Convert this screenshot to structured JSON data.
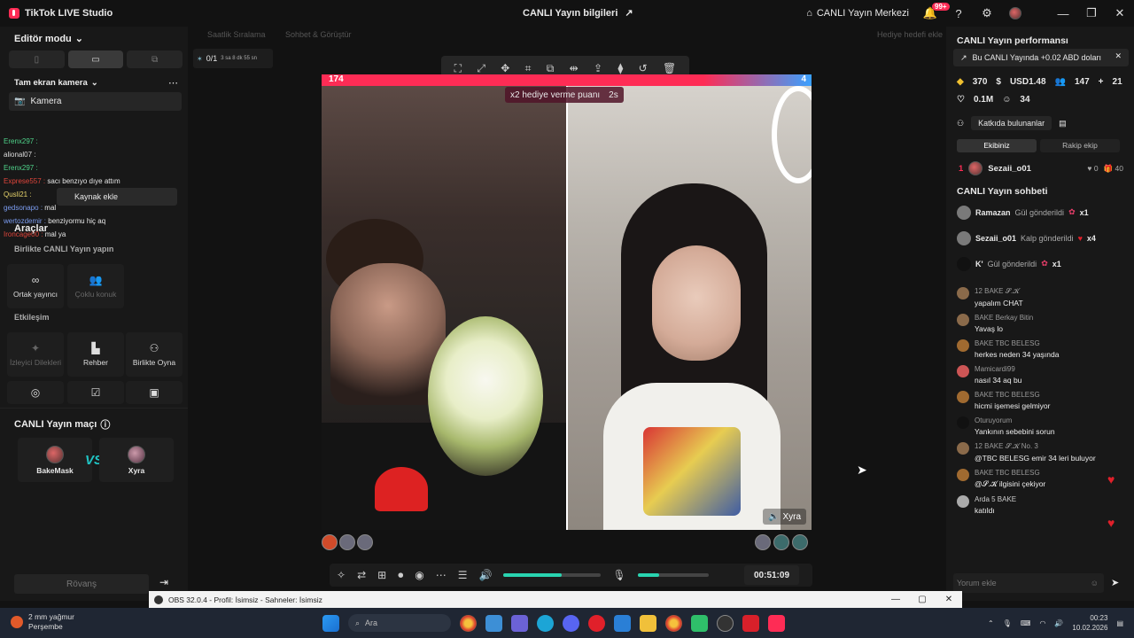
{
  "titlebar": {
    "app_name": "TikTok LIVE Studio",
    "center_title": "CANLI Yayın bilgileri",
    "live_center": "CANLI Yayın Merkezi",
    "notif_badge": "99+"
  },
  "left": {
    "editor_mode": "Editör modu",
    "camera_section": "Tam ekran kamera",
    "camera_item": "Kamera",
    "mini_chat": [
      {
        "user": "Erenx297 :",
        "text": ""
      },
      {
        "user": "alional07 :",
        "text": ""
      },
      {
        "user": "Erenx297 :",
        "text": ""
      },
      {
        "user": "Exprese557 :",
        "text": "sacı benzıyo dıye attım"
      },
      {
        "user": "Qusli21 :",
        "text": ""
      },
      {
        "user": "gedsonapo :",
        "text": "mal"
      },
      {
        "user": "wertozdemir :",
        "text": "benziyormu hiç aq"
      },
      {
        "user": "Ironcage00 :",
        "text": "mal ya"
      }
    ],
    "add_source": "Kaynak ekle",
    "tools_title": "Araçlar",
    "collab_title": "Birlikte CANLI Yayın yapın",
    "tool_cohost": "Ortak yayıncı",
    "tool_multiguest": "Çoklu konuk",
    "interaction_title": "Etkileşim",
    "tool_viewer_wishes": "İzleyici Dilekleri",
    "tool_guide": "Rehber",
    "tool_playtogether": "Birlikte Oyna",
    "match_title": "CANLI Yayın maçı",
    "player1": "BakeMask",
    "player2": "Xyra",
    "vs": "VS",
    "rematch": "Rövanş"
  },
  "stage": {
    "label_left1": "Saatlik Sıralama",
    "label_left2": "Sohbet & Görüştür",
    "label_right": "Hediye hedefi ekle",
    "streak": "0/1",
    "streak_time": "3 sa 8 dk 55 sn",
    "score_left": "174",
    "score_right": "4",
    "gift_multiplier": "x2 hediye verme puanı",
    "gift_timer": "2s",
    "guest_name": "Xyra",
    "elapsed": "00:51:09",
    "volume_level": 0.6,
    "mic_level": 0.3
  },
  "right": {
    "perf_title": "CANLI Yayın performansı",
    "earn_text": "Bu CANLI Yayında +0.02 ABD doları",
    "stat_diamonds": "370",
    "stat_usd": "USD1.48",
    "stat_viewers": "147",
    "stat_follows": "21",
    "stat_likes": "0.1M",
    "stat_gifters": "34",
    "contrib_btn": "Katkıda bulunanlar",
    "tab_team": "Ekibiniz",
    "tab_rival": "Rakip ekip",
    "rank_no": "1",
    "rank_user": "Sezaii_o01",
    "rank_likes": "0",
    "rank_gifts": "40",
    "chat_title": "CANLI Yayın sohbeti",
    "gifts": [
      {
        "user": "Ramazan",
        "action": "Gül gönderildi",
        "count": "x1"
      },
      {
        "user": "Sezaii_o01",
        "action": "Kalp gönderildi",
        "count": "x4"
      },
      {
        "user": "K'",
        "action": "Gül gönderildi",
        "count": "x1"
      }
    ],
    "messages": [
      {
        "name": "12  BAKE 𝓢.𝓚",
        "text": "yapalım CHAT"
      },
      {
        "name": "BAKE Berkay Bitin",
        "text": "Yavaş lo"
      },
      {
        "name": "BAKE TBC BELESG",
        "text": "herkes neden 34 yaşında"
      },
      {
        "name": "Mamicardi99",
        "text": "nasıl 34 aq bu"
      },
      {
        "name": "BAKE TBC BELESG",
        "text": "hicmi işemesi gelmiyor"
      },
      {
        "name": "Oturuyorum",
        "text": "Yankının sebebini sorun"
      },
      {
        "name": "12  BAKE 𝓢.𝓚  No. 3",
        "text": "@TBC BELESG emir 34 leri buluyor"
      },
      {
        "name": "BAKE TBC BELESG",
        "text": "@𝓢.𝓚 ilgisini çekiyor"
      },
      {
        "name": "Arda  5  BAKE",
        "text": "katıldı"
      }
    ],
    "comment_placeholder": "Yorum ekle"
  },
  "obs": {
    "title": "OBS 32.0.4 - Profil: İsimsiz - Sahneler: İsimsiz"
  },
  "taskbar": {
    "weather_line1": "2 mm yağmur",
    "weather_line2": "Perşembe",
    "search": "Ara",
    "time": "00:23",
    "date": "10.02.2026"
  }
}
